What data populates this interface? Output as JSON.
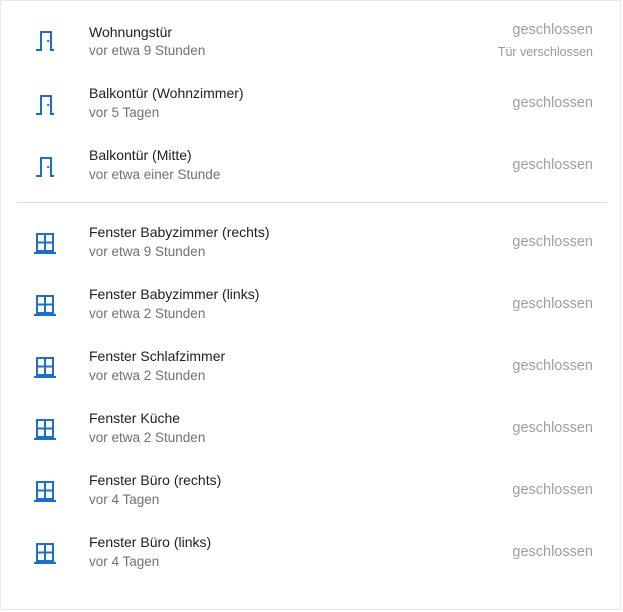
{
  "accent_color": "#1e6fc8",
  "doors": [
    {
      "icon": "door-icon",
      "name": "Wohnungstür",
      "time": "vor etwa 9 Stunden",
      "state": "geschlossen",
      "sub_state": "Tür verschlossen"
    },
    {
      "icon": "door-icon",
      "name": "Balkontür (Wohnzimmer)",
      "time": "vor 5 Tagen",
      "state": "geschlossen"
    },
    {
      "icon": "door-icon",
      "name": "Balkontür (Mitte)",
      "time": "vor etwa einer Stunde",
      "state": "geschlossen"
    }
  ],
  "windows": [
    {
      "icon": "window-icon",
      "name": "Fenster Babyzimmer (rechts)",
      "time": "vor etwa 9 Stunden",
      "state": "geschlossen"
    },
    {
      "icon": "window-icon",
      "name": "Fenster Babyzimmer (links)",
      "time": "vor etwa 2 Stunden",
      "state": "geschlossen"
    },
    {
      "icon": "window-icon",
      "name": "Fenster Schlafzimmer",
      "time": "vor etwa 2 Stunden",
      "state": "geschlossen"
    },
    {
      "icon": "window-icon",
      "name": "Fenster Küche",
      "time": "vor etwa 2 Stunden",
      "state": "geschlossen"
    },
    {
      "icon": "window-icon",
      "name": "Fenster Büro (rechts)",
      "time": "vor 4 Tagen",
      "state": "geschlossen"
    },
    {
      "icon": "window-icon",
      "name": "Fenster Büro (links)",
      "time": "vor 4 Tagen",
      "state": "geschlossen"
    }
  ]
}
